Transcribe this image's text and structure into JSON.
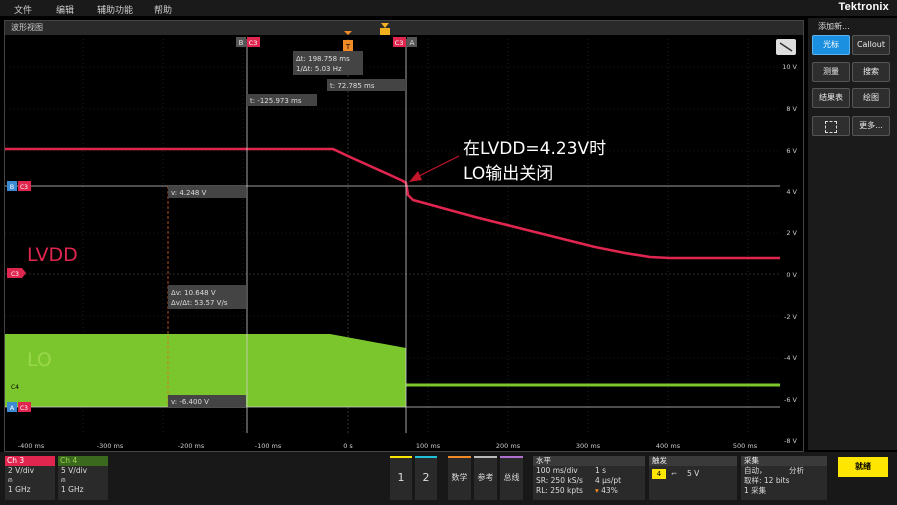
{
  "menu": {
    "file": "文件",
    "edit": "编辑",
    "utility": "辅助功能",
    "help": "帮助",
    "brand": "Tektronix"
  },
  "waveform_view": {
    "title": "波形视图",
    "x_ticks": [
      "-400 ms",
      "-300 ms",
      "-200 ms",
      "-100 ms",
      "0 s",
      "100 ms",
      "200 ms",
      "300 ms",
      "400 ms",
      "500 ms"
    ],
    "y_ticks": [
      "10 V",
      "8 V",
      "6 V",
      "4 V",
      "2 V",
      "0 V",
      "-2 V",
      "-4 V",
      "-6 V",
      "-8 V"
    ],
    "cursor_b_label": "B",
    "cursor_a_label": "A",
    "cursor_ch_label": "C3",
    "trigger_label": "T",
    "readouts": {
      "delta_t": "Δt: 198.758 ms",
      "inv_delta_t": "1/Δt: 5.03 Hz",
      "t_a": "t: 72.785 ms",
      "t_b": "t: -125.973 ms",
      "v_b": "v: 4.248 V",
      "delta_v": "Δv: 10.648 V",
      "delta_v_dt": "Δv/Δt: 53.57 V/s",
      "v_a": "v: -6.400 V"
    },
    "markers": {
      "b": "B",
      "a": "A",
      "c3": "C3",
      "c4": "C4"
    },
    "annotation_line1": "在LVDD=4.23V时",
    "annotation_line2": "LO输出关闭",
    "lvdd_label": "LVDD",
    "lo_label": "LO",
    "colors": {
      "ch3": "#e0264f",
      "ch4": "#7cc62d",
      "annotation_arrow": "#c4162c"
    }
  },
  "side_panel": {
    "title": "添加新...",
    "cursor": "光标",
    "callout": "Callout",
    "measure": "测量",
    "search": "搜索",
    "results_table": "结果表",
    "plot": "绘图",
    "more": "更多..."
  },
  "bottom": {
    "ch3": {
      "name": "Ch 3",
      "scale": "2 V/div",
      "bw": "1 GHz"
    },
    "ch4": {
      "name": "Ch 4",
      "scale": "5 V/div",
      "bw": "1 GHz"
    },
    "btn1": "1",
    "btn2": "2",
    "math": "数学",
    "ref": "参考",
    "bus": "总线",
    "horizontal": {
      "title": "水平",
      "scale": "100 ms/div",
      "duration": "1 s",
      "sr": "SR: 250 kS/s",
      "pt": "4 μs/pt",
      "rl": "RL: 250 kpts",
      "pos": "43%"
    },
    "trigger": {
      "title": "触发",
      "level": "5 V",
      "source": "4"
    },
    "acquire": {
      "title": "采集",
      "mode": "自动，",
      "analyze": "分析",
      "sample": "取样: 12 bits",
      "count": "1 采集"
    },
    "ready": "就绪"
  }
}
